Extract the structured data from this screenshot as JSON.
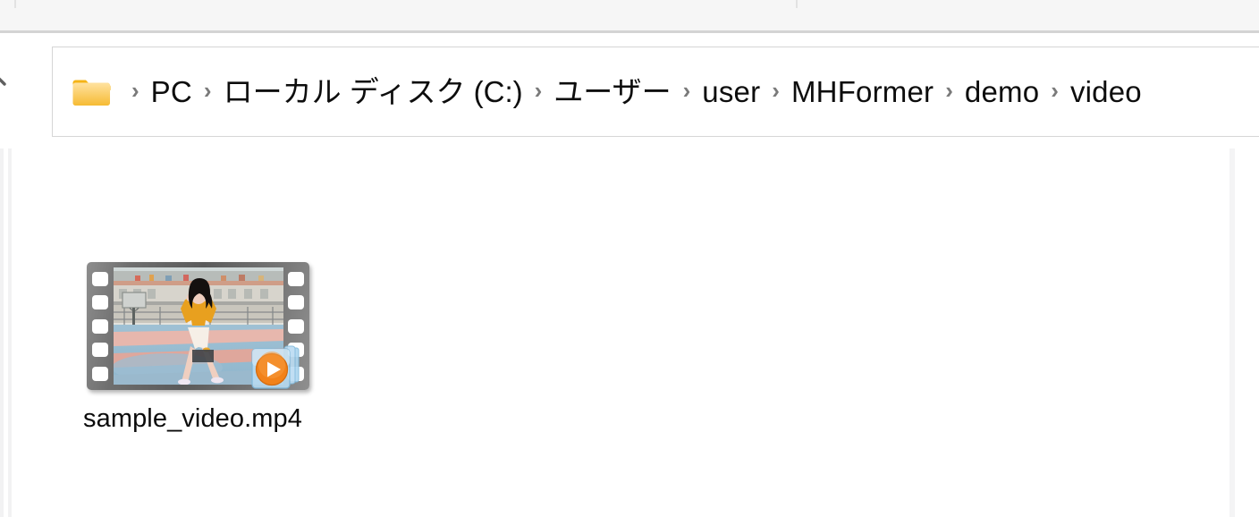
{
  "window": {
    "background_color": "#ffffff",
    "toolbar_color": "#f6f6f6"
  },
  "navigation": {
    "back_forward_chevron_icon": "chevron-right-icon"
  },
  "address_bar": {
    "folder_icon": "folder-icon",
    "separator": "›",
    "crumbs": [
      {
        "label": "PC"
      },
      {
        "label": "ローカル ディスク (C:)"
      },
      {
        "label": "ユーザー"
      },
      {
        "label": "user"
      },
      {
        "label": "MHFormer"
      },
      {
        "label": "demo"
      },
      {
        "label": "video"
      }
    ]
  },
  "content": {
    "files": [
      {
        "name": "sample_video.mp4",
        "icon": "video-file-thumbnail-icon",
        "overlay_icon": "media-player-play-icon",
        "thumbnail_description": "dancer on an outdoor basketball court"
      }
    ]
  },
  "colors": {
    "accent_orange": "#f07d16",
    "folder_yellow": "#fcc62e",
    "separator_gray": "#7a7a7a",
    "border_gray": "#d6d6d6",
    "text_black": "#0d0d0d"
  }
}
